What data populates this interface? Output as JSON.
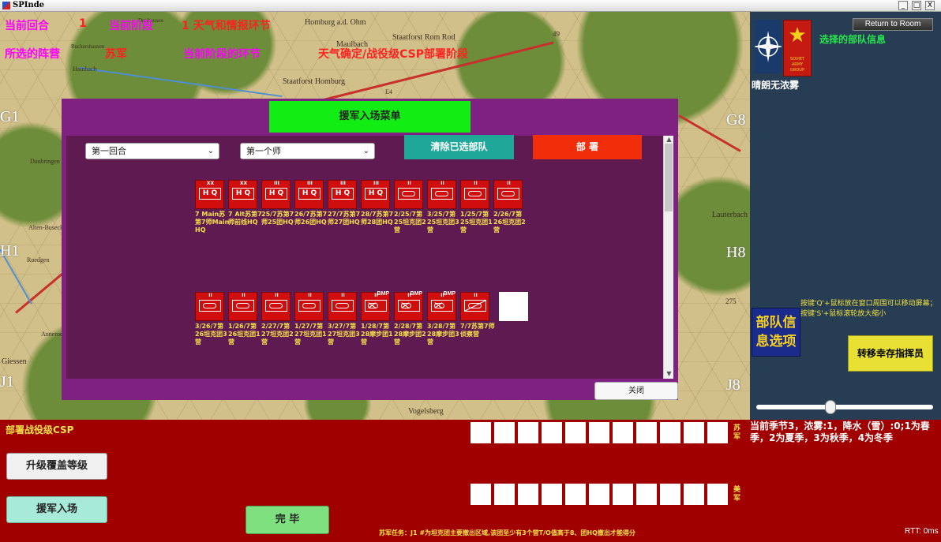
{
  "window": {
    "title": "SPInde",
    "buttons": [
      "_",
      "□",
      "X"
    ]
  },
  "map": {
    "places": [
      "Homburg a.d. Ohm",
      "Staatforst Rom Rod",
      "Staatforst Homburg",
      "Maulbach",
      "Vogelsberg",
      "Lauterbach",
      "Daubringen",
      "Alten-Buseck",
      "Roedgen",
      "Annerod",
      "Giessen",
      "Hainbach",
      "Ruckershausen",
      "Dreihausen"
    ],
    "grid_labels": [
      "G1",
      "H1",
      "J1",
      "G8",
      "H8",
      "J8",
      "E4"
    ],
    "hex_numbers": [
      "49",
      "275"
    ]
  },
  "overlay": {
    "turn_label": "当前回合",
    "turn_value": "1",
    "phase_label": "当前阶段",
    "phase_value": "1 天气和情报环节",
    "camp_label": "所选的阵营",
    "camp_value": "苏军",
    "step_label": "当前阶段的环节",
    "step_value": "天气确定/战役级CSP部署阶段"
  },
  "right_panel": {
    "return_btn": "Return to Room",
    "selected_unit_info": "选择的部队信息",
    "soviet_badge_caption": "SOVIET ARMY GROUP",
    "weather": "晴朗无浓雾",
    "hint": "按键'Q'+鼠标放在窗口周围可以移动屏幕；按键'S'+鼠标滚轮放大缩小",
    "unit_info_option": "部队信息选项",
    "transfer_btn": "转移幸存指挥员",
    "zoom_slider_value": 0.42
  },
  "dialog": {
    "title": "援军入场菜单",
    "turn_select": "第一回合",
    "division_select": "第一个师",
    "clear_btn": "清除已选部队",
    "deploy_btn": "部 署",
    "close_btn": "关闭",
    "row1": [
      {
        "echelon": "XX",
        "sym": "HQ",
        "label": "7 Main苏第7师Main HQ"
      },
      {
        "echelon": "XX",
        "sym": "HQ",
        "label": "7 Alt苏第7师前线HQ"
      },
      {
        "echelon": "III",
        "sym": "HQ",
        "label": "25/7苏第7师25团HQ"
      },
      {
        "echelon": "III",
        "sym": "HQ",
        "label": "26/7苏第7师26团HQ"
      },
      {
        "echelon": "III",
        "sym": "HQ",
        "label": "27/7苏第7师27团HQ"
      },
      {
        "echelon": "III",
        "sym": "HQ",
        "label": "28/7苏第7师28团HQ"
      },
      {
        "echelon": "II",
        "sym": "armor",
        "label": "2/25/7第25坦克团2营"
      },
      {
        "echelon": "II",
        "sym": "armor",
        "label": "3/25/7第25坦克团3营"
      },
      {
        "echelon": "II",
        "sym": "armor",
        "label": "1/25/7第25坦克团1营"
      },
      {
        "echelon": "II",
        "sym": "armor",
        "label": "2/26/7第26坦克团2营"
      }
    ],
    "row2": [
      {
        "echelon": "II",
        "sym": "armor",
        "label": "3/26/7第26坦克团3营"
      },
      {
        "echelon": "II",
        "sym": "armor",
        "label": "1/26/7第26坦克团1营"
      },
      {
        "echelon": "II",
        "sym": "armor",
        "label": "2/27/7第27坦克团2营"
      },
      {
        "echelon": "II",
        "sym": "armor",
        "label": "1/27/7第27坦克团1营"
      },
      {
        "echelon": "II",
        "sym": "armor",
        "label": "3/27/7第27坦克团3营"
      },
      {
        "echelon": "II",
        "sym": "mech",
        "badge": "BMP",
        "label": "1/28/7第28摩步团1营"
      },
      {
        "echelon": "II",
        "sym": "mech",
        "badge": "BMP",
        "label": "2/28/7第28摩步团2营"
      },
      {
        "echelon": "II",
        "sym": "mech",
        "badge": "BMP",
        "label": "3/28/7第28摩步团3营"
      },
      {
        "echelon": "II",
        "sym": "recon",
        "label": "7/7苏第7师侦察营"
      }
    ]
  },
  "bottom_panel": {
    "deploy_csp": "部署战役级CSP",
    "upgrade_btn": "升级覆盖等级",
    "reinforce_btn": "援军入场",
    "done_btn": "完 毕",
    "soviet_label": "苏军",
    "us_label": "美军",
    "season": "当前季节3，浓雾:1，降水（雪）:0;1为春季，2为夏季，3为秋季，4为冬季",
    "mission": "苏军任务：J1 #为坦克团主要撤出区域,该团至少有3个营T/O值高于8、团HQ撤出才能得分",
    "rtt": "RTT: 0ms",
    "slot_count": 11
  },
  "colors": {
    "map_bg": "#d2c08a",
    "dialog_bg": "#7e2180",
    "dialog_content": "#5f1a52",
    "bottom_bg": "#a00000",
    "right_panel_bg": "#263d54",
    "counter_red": "#d10e0e",
    "accent_green": "#12ee14"
  },
  "icons": [
    "app-icon",
    "nato-star-icon",
    "soviet-star-icon",
    "hq-symbol-icon",
    "armor-symbol-icon",
    "mech-infantry-symbol-icon",
    "recon-symbol-icon",
    "chevron-down-icon"
  ]
}
